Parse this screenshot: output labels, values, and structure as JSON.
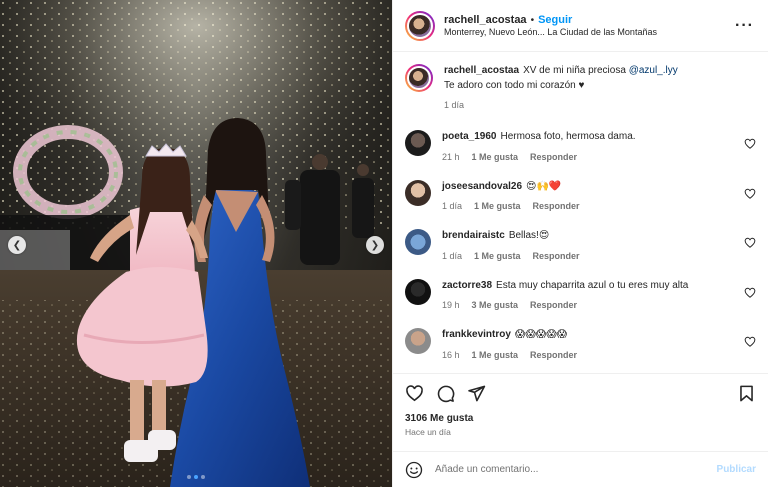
{
  "post": {
    "username": "rachell_acostaa",
    "follow_label": "Seguir",
    "location": "Monterrey, Nuevo León... La Ciudad de las Montañas",
    "more_icon": "more-horizontal-icon"
  },
  "caption": {
    "username": "rachell_acostaa",
    "text": "XV de mi niña preciosa",
    "mention": "@azul_.lyy",
    "line2": "Te adoro con todo mi corazón ♥",
    "time": "1 día"
  },
  "comments": [
    {
      "username": "poeta_1960",
      "text": "Hermosa foto, hermosa dama.",
      "time": "21 h",
      "likes": "1 Me gusta",
      "reply": "Responder"
    },
    {
      "username": "joseesandoval26",
      "text": "😍🙌❤️",
      "time": "1 día",
      "likes": "1 Me gusta",
      "reply": "Responder"
    },
    {
      "username": "brendairaistc",
      "text": "Bellas!😍",
      "time": "1 día",
      "likes": "1 Me gusta",
      "reply": "Responder"
    },
    {
      "username": "zactorre38",
      "text": "Esta muy chaparrita azul o tu eres muy alta",
      "time": "19 h",
      "likes": "3 Me gusta",
      "reply": "Responder"
    },
    {
      "username": "frankkevintroy",
      "text": "😱😱😱😱😱",
      "time": "16 h",
      "likes": "1 Me gusta",
      "reply": "Responder"
    }
  ],
  "stats": {
    "likes": "3106 Me gusta",
    "ago": "Hace un día"
  },
  "composer": {
    "placeholder": "Añade un comentario...",
    "publish_label": "Publicar"
  },
  "carousel": {
    "prev_glyph": "❮",
    "next_glyph": "❯",
    "current": 1,
    "total": 3
  },
  "colors": {
    "accent": "#0095f6",
    "publish_disabled": "#b3dbff",
    "dress_blue": "#1e4fa8",
    "dress_pink": "#f4c6cf"
  }
}
